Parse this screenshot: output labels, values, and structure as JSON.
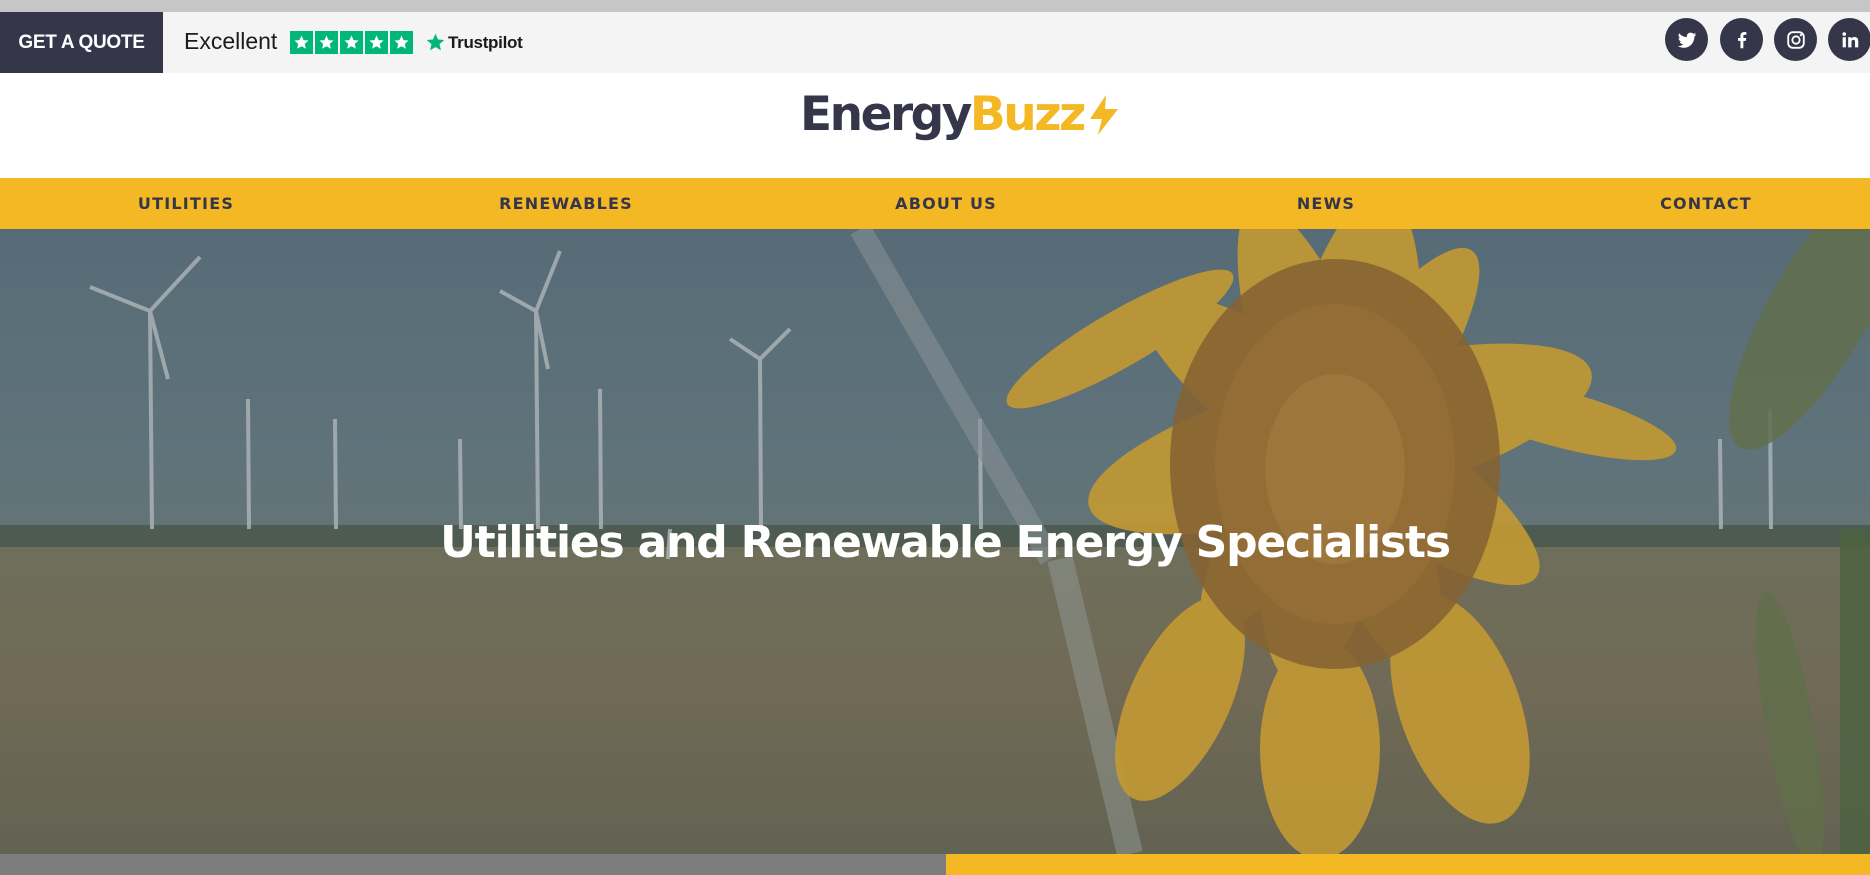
{
  "topbar": {
    "quote_button": "GET A QUOTE",
    "rating_text": "Excellent",
    "rating_stars": 5,
    "trustpilot_label": "Trustpilot",
    "social_icons": [
      "twitter-icon",
      "facebook-icon",
      "instagram-icon",
      "linkedin-icon"
    ]
  },
  "logo": {
    "part1": "Energy",
    "part2": "Buzz",
    "icon": "lightning-bolt-icon"
  },
  "nav": {
    "items": [
      {
        "label": "UTILITIES"
      },
      {
        "label": "RENEWABLES"
      },
      {
        "label": "ABOUT US"
      },
      {
        "label": "NEWS"
      },
      {
        "label": "CONTACT"
      }
    ]
  },
  "hero": {
    "title": "Utilities and Renewable Energy Specialists"
  },
  "colors": {
    "accent": "#f3b824",
    "dark": "#35364a",
    "trustpilot_green": "#00b67a"
  }
}
